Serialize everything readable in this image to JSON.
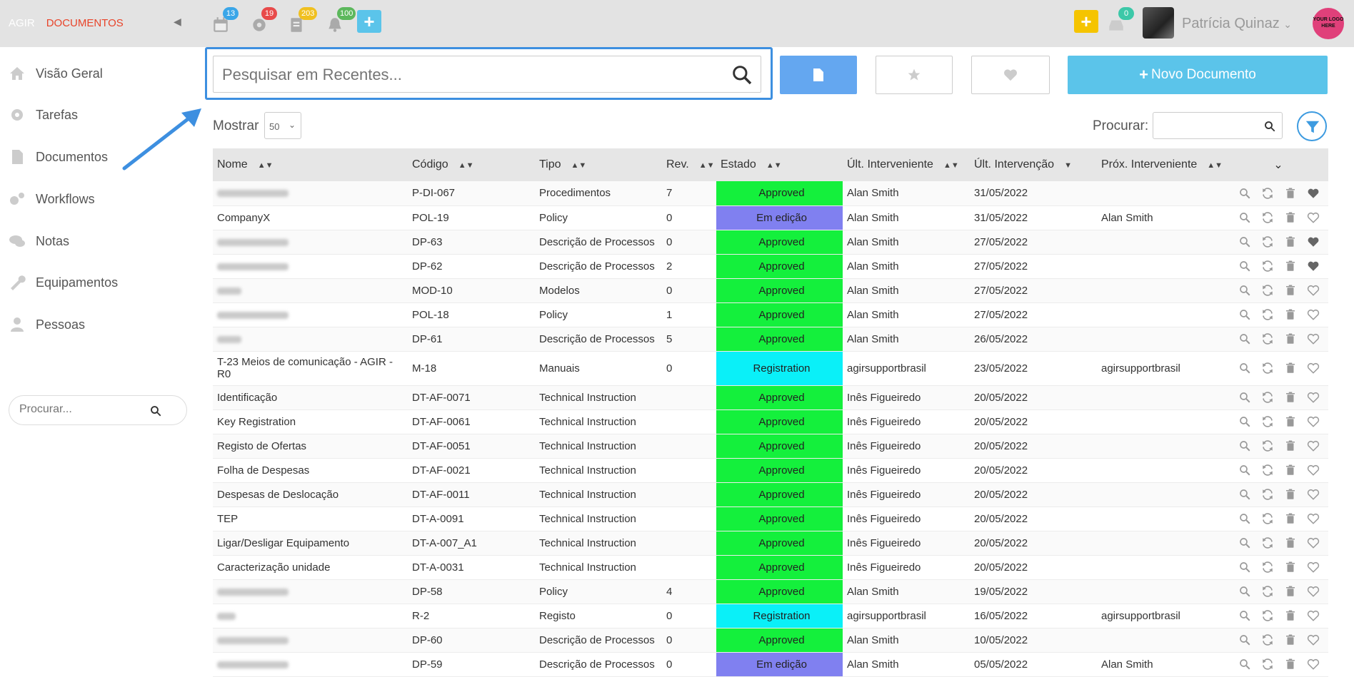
{
  "topbar": {
    "brand_a": "AGIR",
    "brand_d": "DOCUMENTOS",
    "badges": [
      "13",
      "19",
      "203",
      "100"
    ],
    "msg_badge": "0",
    "user_name": "Patrícia Quinaz",
    "logo_text": "YOUR LOGO HERE",
    "colors": {
      "badge_blue": "#3aa6e8",
      "badge_red": "#e84a4a",
      "badge_yellow": "#f0c020",
      "badge_green": "#5cb85c",
      "plus_blue": "#5bc4ea",
      "plus_yellow": "#f5c400"
    }
  },
  "sidebar": {
    "items": [
      {
        "label": "Visão Geral",
        "icon": "home-icon"
      },
      {
        "label": "Tarefas",
        "icon": "gear-icon"
      },
      {
        "label": "Documentos",
        "icon": "document-icon"
      },
      {
        "label": "Workflows",
        "icon": "gears-icon"
      },
      {
        "label": "Notas",
        "icon": "comments-icon"
      },
      {
        "label": "Equipamentos",
        "icon": "wrench-icon"
      },
      {
        "label": "Pessoas",
        "icon": "user-icon"
      }
    ],
    "search_placeholder": "Procurar..."
  },
  "main": {
    "search_placeholder": "Pesquisar em Recentes...",
    "new_doc_label": "Novo Documento",
    "show_label": "Mostrar",
    "show_value": "50",
    "find_label": "Procurar:"
  },
  "table": {
    "columns": [
      "Nome",
      "Código",
      "Tipo",
      "Rev.",
      "Estado",
      "Últ. Interveniente",
      "Últ. Intervenção",
      "Próx. Interveniente"
    ],
    "rows": [
      {
        "name": "",
        "blur": 100,
        "code": "P-DI-067",
        "type": "Procedimentos",
        "rev": "7",
        "state": "Approved",
        "cls": "approved",
        "last": "Alan Smith",
        "date": "31/05/2022",
        "next": "",
        "fav": true
      },
      {
        "name": "CompanyX",
        "code": "POL-19",
        "type": "Policy",
        "rev": "0",
        "state": "Em edição",
        "cls": "edit",
        "last": "Alan Smith",
        "date": "31/05/2022",
        "next": "Alan Smith",
        "fav": false
      },
      {
        "name": "",
        "blur": 100,
        "code": "DP-63",
        "type": "Descrição de Processos",
        "rev": "0",
        "state": "Approved",
        "cls": "approved",
        "last": "Alan Smith",
        "date": "27/05/2022",
        "next": "",
        "fav": true
      },
      {
        "name": "",
        "blur": 100,
        "code": "DP-62",
        "type": "Descrição de Processos",
        "rev": "2",
        "state": "Approved",
        "cls": "approved",
        "last": "Alan Smith",
        "date": "27/05/2022",
        "next": "",
        "fav": true
      },
      {
        "name": "",
        "blur": 34,
        "code": "MOD-10",
        "type": "Modelos",
        "rev": "0",
        "state": "Approved",
        "cls": "approved",
        "last": "Alan Smith",
        "date": "27/05/2022",
        "next": "",
        "fav": false
      },
      {
        "name": "",
        "blur": 100,
        "code": "POL-18",
        "type": "Policy",
        "rev": "1",
        "state": "Approved",
        "cls": "approved",
        "last": "Alan Smith",
        "date": "27/05/2022",
        "next": "",
        "fav": false
      },
      {
        "name": "",
        "blur": 34,
        "code": "DP-61",
        "type": "Descrição de Processos",
        "rev": "5",
        "state": "Approved",
        "cls": "approved",
        "last": "Alan Smith",
        "date": "26/05/2022",
        "next": "",
        "fav": false
      },
      {
        "name": "T-23 Meios de comunicação - AGIR - R0",
        "code": "M-18",
        "type": "Manuais",
        "rev": "0",
        "state": "Registration",
        "cls": "reg",
        "last": "agirsupportbrasil",
        "date": "23/05/2022",
        "next": "agirsupportbrasil",
        "fav": false,
        "tall": true
      },
      {
        "name": "Identificação",
        "code": "DT-AF-0071",
        "type": "Technical Instruction",
        "rev": "",
        "state": "Approved",
        "cls": "approved",
        "last": "Inês Figueiredo",
        "date": "20/05/2022",
        "next": "",
        "fav": false
      },
      {
        "name": "Key Registration",
        "code": "DT-AF-0061",
        "type": "Technical Instruction",
        "rev": "",
        "state": "Approved",
        "cls": "approved",
        "last": "Inês Figueiredo",
        "date": "20/05/2022",
        "next": "",
        "fav": false
      },
      {
        "name": "Registo de Ofertas",
        "code": "DT-AF-0051",
        "type": "Technical Instruction",
        "rev": "",
        "state": "Approved",
        "cls": "approved",
        "last": "Inês Figueiredo",
        "date": "20/05/2022",
        "next": "",
        "fav": false
      },
      {
        "name": "Folha de Despesas",
        "code": "DT-AF-0021",
        "type": "Technical Instruction",
        "rev": "",
        "state": "Approved",
        "cls": "approved",
        "last": "Inês Figueiredo",
        "date": "20/05/2022",
        "next": "",
        "fav": false
      },
      {
        "name": "Despesas de Deslocação",
        "code": "DT-AF-0011",
        "type": "Technical Instruction",
        "rev": "",
        "state": "Approved",
        "cls": "approved",
        "last": "Inês Figueiredo",
        "date": "20/05/2022",
        "next": "",
        "fav": false
      },
      {
        "name": "TEP",
        "code": "DT-A-0091",
        "type": "Technical Instruction",
        "rev": "",
        "state": "Approved",
        "cls": "approved",
        "last": "Inês Figueiredo",
        "date": "20/05/2022",
        "next": "",
        "fav": false
      },
      {
        "name": "Ligar/Desligar Equipamento",
        "code": "DT-A-007_A1",
        "type": "Technical Instruction",
        "rev": "",
        "state": "Approved",
        "cls": "approved",
        "last": "Inês Figueiredo",
        "date": "20/05/2022",
        "next": "",
        "fav": false
      },
      {
        "name": "Caracterização unidade",
        "code": "DT-A-0031",
        "type": "Technical Instruction",
        "rev": "",
        "state": "Approved",
        "cls": "approved",
        "last": "Inês Figueiredo",
        "date": "20/05/2022",
        "next": "",
        "fav": false
      },
      {
        "name": "",
        "blur": 100,
        "code": "DP-58",
        "type": "Policy",
        "rev": "4",
        "state": "Approved",
        "cls": "approved",
        "last": "Alan Smith",
        "date": "19/05/2022",
        "next": "",
        "fav": false
      },
      {
        "name": "",
        "blur": 26,
        "code": "R-2",
        "type": "Registo",
        "rev": "0",
        "state": "Registration",
        "cls": "reg",
        "last": "agirsupportbrasil",
        "date": "16/05/2022",
        "next": "agirsupportbrasil",
        "fav": false
      },
      {
        "name": "",
        "blur": 100,
        "code": "DP-60",
        "type": "Descrição de Processos",
        "rev": "0",
        "state": "Approved",
        "cls": "approved",
        "last": "Alan Smith",
        "date": "10/05/2022",
        "next": "",
        "fav": false
      },
      {
        "name": "",
        "blur": 100,
        "code": "DP-59",
        "type": "Descrição de Processos",
        "rev": "0",
        "state": "Em edição",
        "cls": "edit",
        "last": "Alan Smith",
        "date": "05/05/2022",
        "next": "Alan Smith",
        "fav": false
      }
    ]
  }
}
